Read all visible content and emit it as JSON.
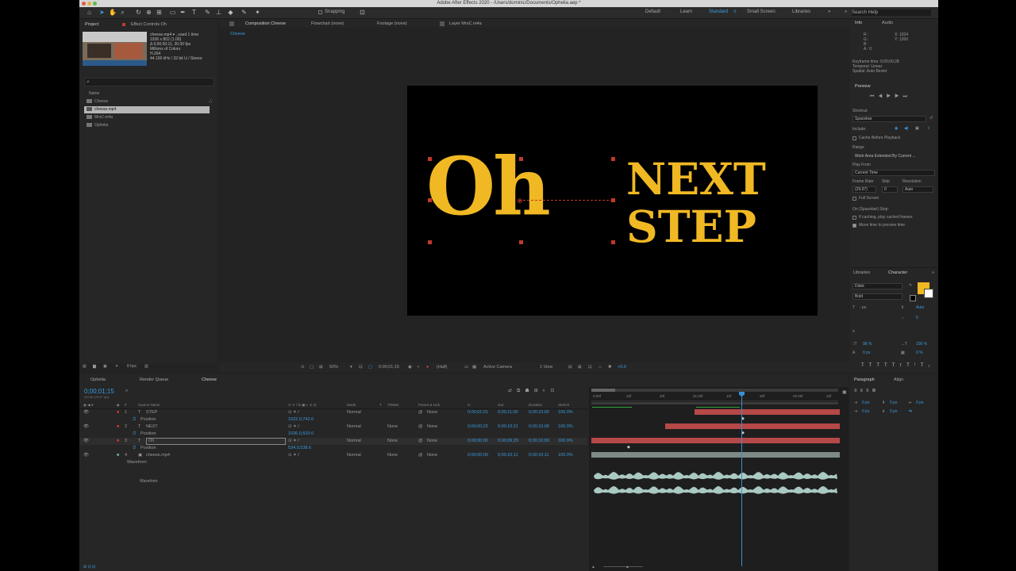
{
  "window": {
    "title": "Adobe After Effects 2020 - /Users/dominic/Documents/Ophelia.aep *"
  },
  "toolbar": {
    "snapping_label": "Snapping",
    "workspaces": [
      "Default",
      "Learn",
      "Standard",
      "Small Screen",
      "Libraries"
    ],
    "active_workspace": "Standard",
    "search_placeholder": "Search Help"
  },
  "project": {
    "tabs": [
      "Project",
      "Effect Controls Oh"
    ],
    "thumb_info": [
      "cheese.mp4 ▾ , used 1 time",
      "1936 x 802 (1.00)",
      "Δ 0;00;50;11, 30.00 fps",
      "Millions of Colors",
      "H.264",
      "44.100 kHz / 32 bit U / Stereo"
    ],
    "search_placeholder": "",
    "column_name": "Name",
    "items": [
      "Cheese",
      "cheese.mp4",
      "MrsC.m4a",
      "Ophelia"
    ],
    "selected_item": "cheese.mp4",
    "bpc": "8 bpc"
  },
  "viewer": {
    "tabs": [
      "Composition Cheese",
      "Flowchart (none)",
      "Footage (none)",
      "Layer MrsC.m4a"
    ],
    "comp_tab": "Cheese",
    "text_big": "Oh",
    "text_line1": "NEXT",
    "text_line2": "STEP",
    "zoom": "50%",
    "timecode": "0;00;01;15",
    "resolution": "(Half)",
    "camera": "Active Camera",
    "views": "1 View",
    "exposure": "+0.0",
    "text_color": "#f0b823"
  },
  "right_panel": {
    "info_tabs": [
      "Info",
      "Audio"
    ],
    "info_lines": [
      "R :",
      "G :",
      "B :",
      "A : 0"
    ],
    "info_xy": [
      "X: 1824",
      "Y: 1260"
    ],
    "keyframe_lines": [
      "Keyframe time: 0;00;00;28",
      "Temporal: Linear",
      "Spatial: Auto Bezier"
    ],
    "preview_title": "Preview",
    "shortcut_label": "Shortcut",
    "shortcut_value": "Spacebar",
    "include_label": "Include:",
    "cache_label": "Cache Before Playback",
    "range_label": "Range",
    "range_value": "Work Area Extended By Current ...",
    "playfrom_label": "Play From",
    "playfrom_value": "Current Time",
    "framerate_label": "Frame Rate",
    "skip_label": "Skip",
    "resolution_label": "Resolution",
    "framerate_value": "(29.97)",
    "skip_value": "0",
    "resolution_value": "Auto",
    "fullscreen_label": "Full Screen",
    "onstop_label": "On (Spacebar) Stop:",
    "ifcaching_label": "If caching, play cached frames",
    "movetime_label": "Move time to preview time",
    "character_tabs": [
      "Libraries",
      "Character"
    ],
    "font": "Didot",
    "style": "Bold",
    "size": "- px",
    "leading": "Auto",
    "tracking": "0",
    "scale_v": "98 %",
    "scale_h": "100 %",
    "baseline": "0 px",
    "tsume": "0 %",
    "fill_color": "#f0b823",
    "paragraph_tabs": [
      "Paragraph",
      "Align"
    ],
    "para_values": [
      "0 px",
      "0 px",
      "0 px",
      "0 px",
      "0 px"
    ]
  },
  "timeline": {
    "tabs": [
      "Ophelia",
      "Render Queue",
      "Cheese"
    ],
    "active_tab": "Cheese",
    "timecode": "0;00;01;15",
    "frame_info": "00045 (29.97 fps)",
    "columns": [
      "#",
      "Source Name",
      "Mode",
      "T",
      "TrkMat",
      "Parent & Link",
      "In",
      "Out",
      "Duration",
      "Stretch"
    ],
    "layers": [
      {
        "num": "1",
        "name": "STEP",
        "mode": "Normal",
        "trkmat": "",
        "parent": "None",
        "in": "0;00;01;01",
        "out": "0;00;11;00",
        "duration": "0;00;10;00",
        "stretch": "100.0%",
        "prop": "Position",
        "prop_value": "1022.0,742.0"
      },
      {
        "num": "2",
        "name": "NEXT",
        "mode": "Normal",
        "trkmat": "None",
        "parent": "None",
        "in": "0;00;00;22",
        "out": "0;00;10;21",
        "duration": "0;00;10;00",
        "stretch": "100.0%",
        "prop": "Position",
        "prop_value": "1036.0,520.0"
      },
      {
        "num": "3",
        "name": "Oh",
        "mode": "Normal",
        "trkmat": "None",
        "parent": "None",
        "in": "0;00;00;00",
        "out": "0;00;09;29",
        "duration": "0;00;10;00",
        "stretch": "100.0%",
        "prop": "Position",
        "prop_value": "534.0,538.6"
      },
      {
        "num": "4",
        "name": "cheese.mp4",
        "mode": "Normal",
        "trkmat": "None",
        "parent": "None",
        "in": "0;00;00;00",
        "out": "0;00;10;11",
        "duration": "0;00;10;11",
        "stretch": "100.0%",
        "prop": "Waveform",
        "prop_value": ""
      }
    ],
    "waveform_label": "Waveform",
    "ruler": [
      "0:00f",
      "10f",
      "20f",
      "01:00f",
      "10f",
      "20f",
      "02:00f",
      "10f"
    ],
    "colors": {
      "layer_bar": "#b74848",
      "audio_bar": "#7d8a86",
      "playhead": "#3a8fd6",
      "workarea": "#2fa43c"
    }
  }
}
